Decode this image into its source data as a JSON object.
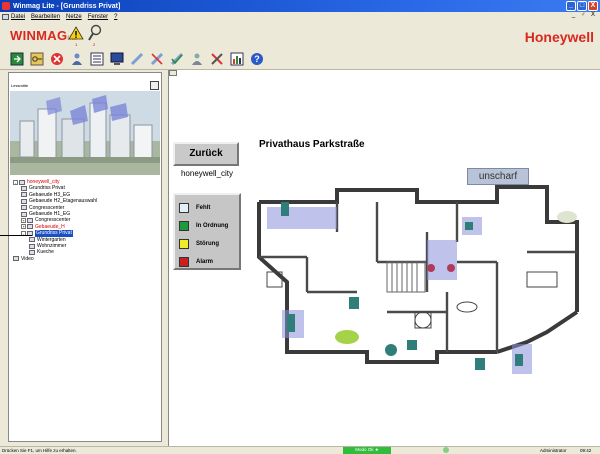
{
  "window": {
    "title": "Winmag Lite - [Grundriss Privat]",
    "buttons": [
      "_",
      "□",
      "X"
    ]
  },
  "menu": {
    "items": [
      "Datei",
      "Bearbeiten",
      "Netze",
      "Fenster",
      "?"
    ],
    "mdi_buttons": "_ ♂ X"
  },
  "brand": {
    "app_logo": "WINMAG",
    "app_logo_suffix": "lite",
    "vendor_logo": "Honeywell",
    "badge_1": "1",
    "badge_2": "2"
  },
  "toolbar": {
    "tools": [
      "exit-icon",
      "key-icon",
      "cancel-icon",
      "operator-icon",
      "list-icon",
      "monitor-icon",
      "pen-icon",
      "cross-out-icon",
      "check-icon",
      "person-icon",
      "tools-icon",
      "chart-icon",
      "help-icon"
    ]
  },
  "sidebar": {
    "header": "Lessmitte",
    "tree": [
      {
        "label": "honeywell_city",
        "level": 0,
        "red": true,
        "exp": "-"
      },
      {
        "label": "Grundriss Privat",
        "level": 1
      },
      {
        "label": "Gebaeude H3_EG",
        "level": 1
      },
      {
        "label": "Gebaeude H2_Etagenauswahl",
        "level": 1
      },
      {
        "label": "Congresscenter",
        "level": 1
      },
      {
        "label": "Gebaeude H1_EG",
        "level": 1
      },
      {
        "label": "Congresscenter",
        "level": 1,
        "exp": "+"
      },
      {
        "label": "Gebaeude_H",
        "level": 1,
        "red": true,
        "exp": "+"
      },
      {
        "label": "Grundriss Privat",
        "level": 1,
        "selected": true,
        "exp": "-"
      },
      {
        "label": "Wintergarten",
        "level": 2
      },
      {
        "label": "Wohnzimmer",
        "level": 2
      },
      {
        "label": "Kueche",
        "level": 2
      },
      {
        "label": "Video",
        "level": 0
      }
    ]
  },
  "main": {
    "back_button": "Zurück",
    "city_label": "honeywell_city",
    "plan_title": "Privathaus Parkstraße",
    "status_tag": "unscharf",
    "legend": [
      {
        "label": "Fehlt",
        "color": "#e4f0f8"
      },
      {
        "label": "In Ordnung",
        "color": "#1e9a3c"
      },
      {
        "label": "Störung",
        "color": "#f0ec28"
      },
      {
        "label": "Alarm",
        "color": "#c82020"
      }
    ]
  },
  "statusbar": {
    "help": "Drücken Sie F1, um Hilfe zu erhalten.",
    "mode": "Modo Ok ★",
    "user": "Administrator",
    "time": "09:42"
  }
}
